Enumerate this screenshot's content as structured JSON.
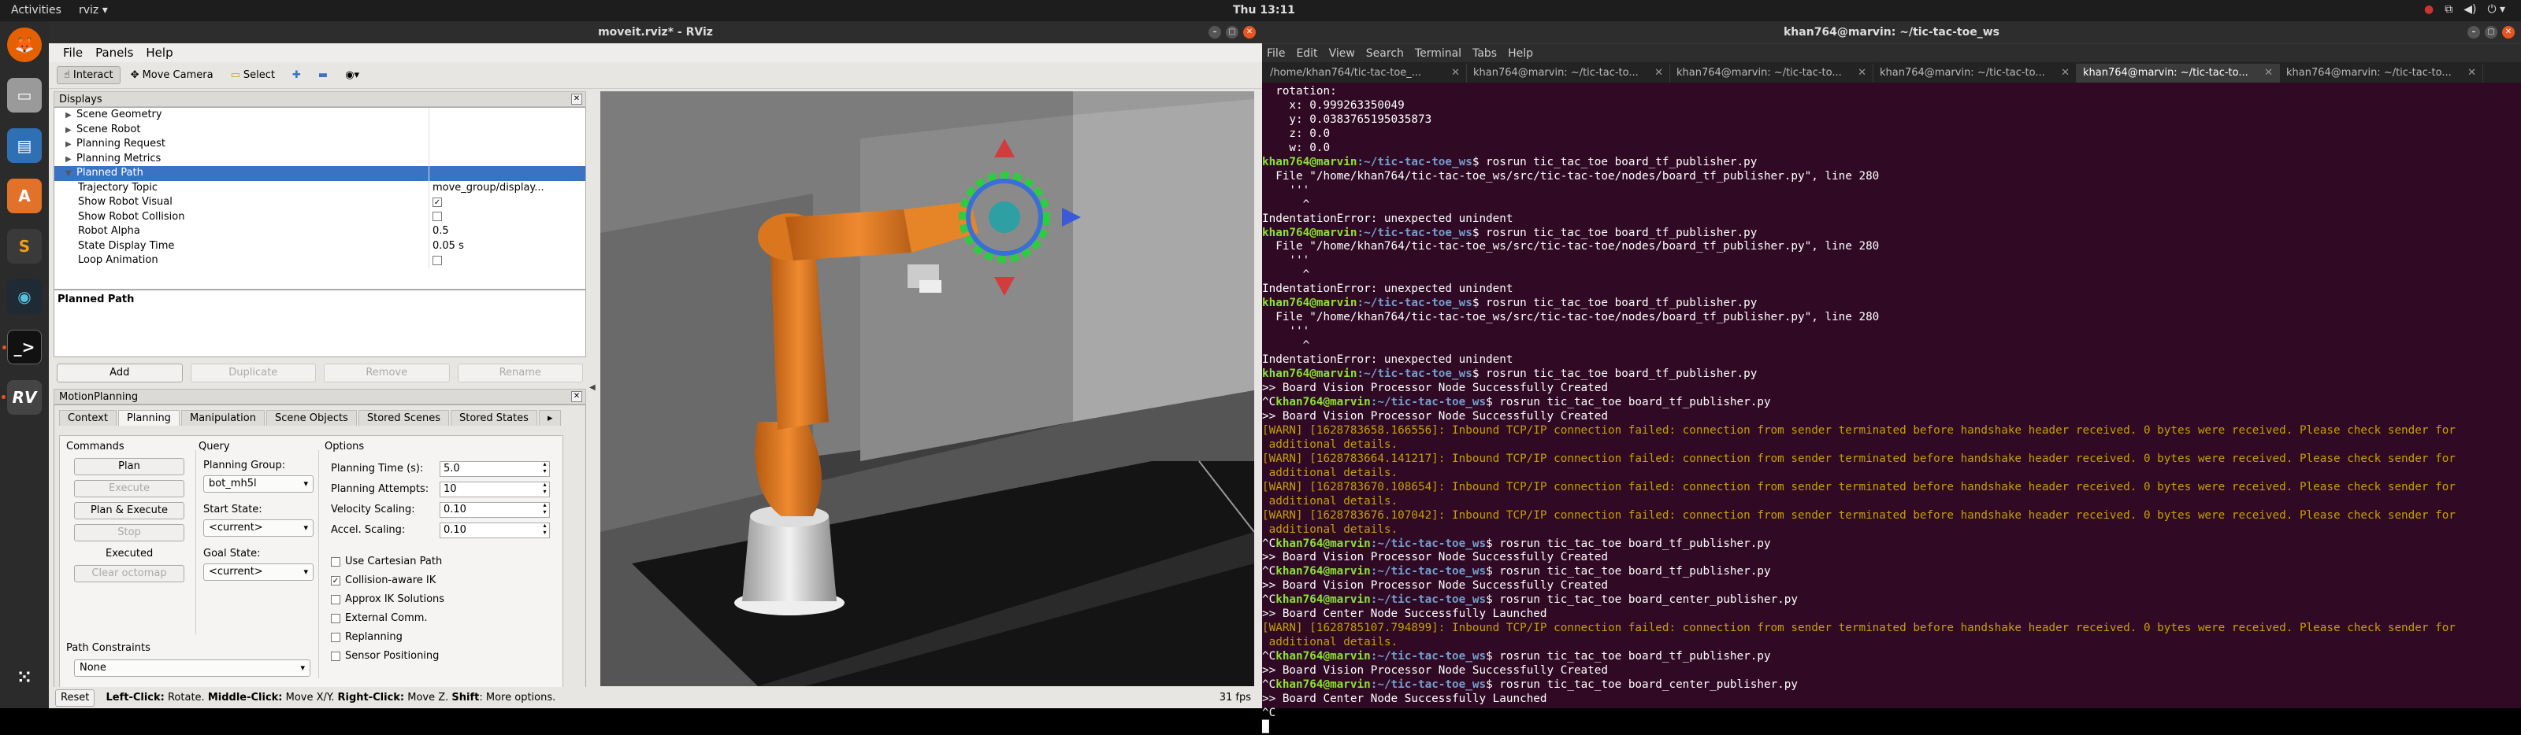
{
  "topbar": {
    "activities": "Activities",
    "app": "rviz ▾",
    "clock": "Thu 13:11"
  },
  "rviz": {
    "title": "moveit.rviz* - RViz",
    "menu": [
      "File",
      "Panels",
      "Help"
    ],
    "toolbar": {
      "interact": "Interact",
      "move_camera": "Move Camera",
      "select": "Select"
    },
    "displays": {
      "title": "Displays",
      "rows": [
        {
          "label": "Scene Geometry",
          "value": "",
          "indent": 1,
          "arrow": "▶"
        },
        {
          "label": "Scene Robot",
          "value": "",
          "indent": 1,
          "arrow": "▶"
        },
        {
          "label": "Planning Request",
          "value": "",
          "indent": 1,
          "arrow": "▶"
        },
        {
          "label": "Planning Metrics",
          "value": "",
          "indent": 1,
          "arrow": "▶"
        },
        {
          "label": "Planned Path",
          "value": "",
          "indent": 1,
          "arrow": "▼",
          "selected": true
        },
        {
          "label": "Trajectory Topic",
          "value": "move_group/display...",
          "indent": 2
        },
        {
          "label": "Show Robot Visual",
          "value": "✓",
          "indent": 2,
          "check": true
        },
        {
          "label": "Show Robot Collision",
          "value": "",
          "indent": 2,
          "check": true
        },
        {
          "label": "Robot Alpha",
          "value": "0.5",
          "indent": 2
        },
        {
          "label": "State Display Time",
          "value": "0.05 s",
          "indent": 2
        },
        {
          "label": "Loop Animation",
          "value": "",
          "indent": 2,
          "check": true
        }
      ],
      "desc_title": "Planned Path",
      "buttons": [
        "Add",
        "Duplicate",
        "Remove",
        "Rename"
      ]
    },
    "motion": {
      "title": "MotionPlanning",
      "tabs": [
        "Context",
        "Planning",
        "Manipulation",
        "Scene Objects",
        "Stored Scenes",
        "Stored States"
      ],
      "commands": "Commands",
      "plan": "Plan",
      "execute": "Execute",
      "plan_execute": "Plan & Execute",
      "stop": "Stop",
      "executed": "Executed",
      "clear_octomap": "Clear octomap",
      "query": "Query",
      "planning_group_lbl": "Planning Group:",
      "planning_group": "bot_mh5l",
      "start_state_lbl": "Start State:",
      "start_state": "<current>",
      "goal_state_lbl": "Goal State:",
      "goal_state": "<current>",
      "options": "Options",
      "planning_time_lbl": "Planning Time (s):",
      "planning_time": "5.0",
      "planning_attempts_lbl": "Planning Attempts:",
      "planning_attempts": "10",
      "velocity_lbl": "Velocity Scaling:",
      "velocity": "0.10",
      "accel_lbl": "Accel. Scaling:",
      "accel": "0.10",
      "checks": [
        {
          "label": "Use Cartesian Path",
          "on": false
        },
        {
          "label": "Collision-aware IK",
          "on": true
        },
        {
          "label": "Approx IK Solutions",
          "on": false
        },
        {
          "label": "External Comm.",
          "on": false
        },
        {
          "label": "Replanning",
          "on": false
        },
        {
          "label": "Sensor Positioning",
          "on": false
        }
      ],
      "path_constraints_lbl": "Path Constraints",
      "path_constraints": "None"
    },
    "status": {
      "reset": "Reset",
      "l1": "Left-Click:",
      "t1": " Rotate. ",
      "l2": "Middle-Click:",
      "t2": " Move X/Y. ",
      "l3": "Right-Click:",
      "t3": " Move Z. ",
      "l4": "Shift",
      "t4": ": More options.",
      "fps": "31 fps"
    }
  },
  "terminal": {
    "title": "khan764@marvin: ~/tic-tac-toe_ws",
    "menu": [
      "File",
      "Edit",
      "View",
      "Search",
      "Terminal",
      "Tabs",
      "Help"
    ],
    "tabs": [
      "/home/khan764/tic-tac-toe_...",
      "khan764@marvin: ~/tic-tac-to...",
      "khan764@marvin: ~/tic-tac-to...",
      "khan764@marvin: ~/tic-tac-to...",
      "khan764@marvin: ~/tic-tac-to...",
      "khan764@marvin: ~/tic-tac-to..."
    ],
    "active_tab": 4,
    "prompt_user": "khan764@marvin",
    "prompt_path": ":~/tic-tac-toe_ws",
    "lines": [
      {
        "t": "n",
        "s": "  rotation:"
      },
      {
        "t": "n",
        "s": "    x: 0.999263350049"
      },
      {
        "t": "n",
        "s": "    y: 0.0383765195035873"
      },
      {
        "t": "n",
        "s": "    z: 0.0"
      },
      {
        "t": "n",
        "s": "    w: 0.0"
      },
      {
        "t": "p",
        "pre": "",
        "s": "$ rosrun tic_tac_toe board_tf_publisher.py"
      },
      {
        "t": "n",
        "s": "  File \"/home/khan764/tic-tac-toe_ws/src/tic-tac-toe/nodes/board_tf_publisher.py\", line 280"
      },
      {
        "t": "n",
        "s": "    '''"
      },
      {
        "t": "n",
        "s": "      ^"
      },
      {
        "t": "n",
        "s": "IndentationError: unexpected unindent"
      },
      {
        "t": "p",
        "pre": "",
        "s": "$ rosrun tic_tac_toe board_tf_publisher.py"
      },
      {
        "t": "n",
        "s": "  File \"/home/khan764/tic-tac-toe_ws/src/tic-tac-toe/nodes/board_tf_publisher.py\", line 280"
      },
      {
        "t": "n",
        "s": "    '''"
      },
      {
        "t": "n",
        "s": "      ^"
      },
      {
        "t": "n",
        "s": "IndentationError: unexpected unindent"
      },
      {
        "t": "p",
        "pre": "",
        "s": "$ rosrun tic_tac_toe board_tf_publisher.py"
      },
      {
        "t": "n",
        "s": "  File \"/home/khan764/tic-tac-toe_ws/src/tic-tac-toe/nodes/board_tf_publisher.py\", line 280"
      },
      {
        "t": "n",
        "s": "    '''"
      },
      {
        "t": "n",
        "s": "      ^"
      },
      {
        "t": "n",
        "s": "IndentationError: unexpected unindent"
      },
      {
        "t": "p",
        "pre": "",
        "s": "$ rosrun tic_tac_toe board_tf_publisher.py"
      },
      {
        "t": "n",
        "s": ">> Board Vision Processor Node Successfully Created"
      },
      {
        "t": "p",
        "pre": "^C",
        "s": "$ rosrun tic_tac_toe board_tf_publisher.py"
      },
      {
        "t": "n",
        "s": ">> Board Vision Processor Node Successfully Created"
      },
      {
        "t": "w",
        "s": "[WARN] [1628783658.166556]: Inbound TCP/IP connection failed: connection from sender terminated before handshake header received. 0 bytes were received. Please check sender for"
      },
      {
        "t": "w",
        "s": " additional details."
      },
      {
        "t": "w",
        "s": "[WARN] [1628783664.141217]: Inbound TCP/IP connection failed: connection from sender terminated before handshake header received. 0 bytes were received. Please check sender for"
      },
      {
        "t": "w",
        "s": " additional details."
      },
      {
        "t": "w",
        "s": "[WARN] [1628783670.108654]: Inbound TCP/IP connection failed: connection from sender terminated before handshake header received. 0 bytes were received. Please check sender for"
      },
      {
        "t": "w",
        "s": " additional details."
      },
      {
        "t": "w",
        "s": "[WARN] [1628783676.107042]: Inbound TCP/IP connection failed: connection from sender terminated before handshake header received. 0 bytes were received. Please check sender for"
      },
      {
        "t": "w",
        "s": " additional details."
      },
      {
        "t": "p",
        "pre": "^C",
        "s": "$ rosrun tic_tac_toe board_tf_publisher.py"
      },
      {
        "t": "n",
        "s": ">> Board Vision Processor Node Successfully Created"
      },
      {
        "t": "p",
        "pre": "^C",
        "s": "$ rosrun tic_tac_toe board_tf_publisher.py"
      },
      {
        "t": "n",
        "s": ">> Board Vision Processor Node Successfully Created"
      },
      {
        "t": "p",
        "pre": "^C",
        "s": "$ rosrun tic_tac_toe board_center_publisher.py"
      },
      {
        "t": "n",
        "s": ">> Board Center Node Successfully Launched"
      },
      {
        "t": "w",
        "s": "[WARN] [1628785107.794899]: Inbound TCP/IP connection failed: connection from sender terminated before handshake header received. 0 bytes were received. Please check sender for"
      },
      {
        "t": "w",
        "s": " additional details."
      },
      {
        "t": "p",
        "pre": "^C",
        "s": "$ rosrun tic_tac_toe board_tf_publisher.py"
      },
      {
        "t": "n",
        "s": ">> Board Vision Processor Node Successfully Created"
      },
      {
        "t": "p",
        "pre": "^C",
        "s": "$ rosrun tic_tac_toe board_center_publisher.py"
      },
      {
        "t": "n",
        "s": ">> Board Center Node Successfully Launched"
      },
      {
        "t": "n",
        "s": "^C"
      }
    ]
  },
  "colors": {
    "terminal_bg": "#300a24",
    "prompt_user": "#8ae234",
    "prompt_path": "#729fcf",
    "warn": "#c4a000",
    "robot": "#e07a1f",
    "selection": "#3a73c4"
  }
}
